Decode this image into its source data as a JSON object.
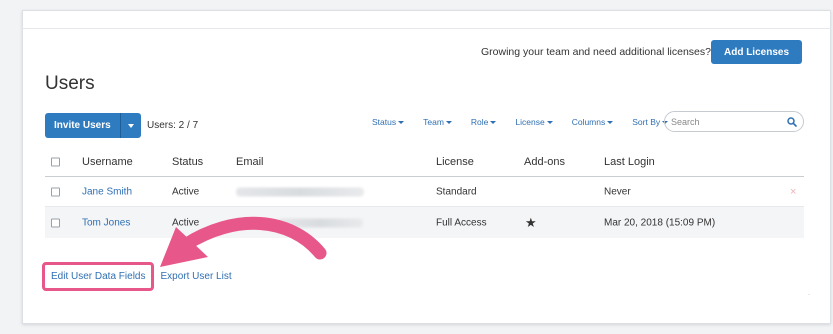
{
  "header": {
    "license_prompt": "Growing your team and need additional licenses?",
    "add_licenses_label": "Add Licenses"
  },
  "page": {
    "title": "Users"
  },
  "toolbar": {
    "invite_label": "Invite Users",
    "users_count": "Users: 2 / 7",
    "filters": [
      "Status",
      "Team",
      "Role",
      "License",
      "Columns",
      "Sort By"
    ],
    "search_placeholder": "Search"
  },
  "table": {
    "columns": [
      "Username",
      "Status",
      "Email",
      "License",
      "Add-ons",
      "Last Login"
    ],
    "rows": [
      {
        "username": "Jane Smith",
        "status": "Active",
        "license": "Standard",
        "addon": "",
        "last_login": "Never",
        "delete": "×"
      },
      {
        "username": "Tom Jones",
        "status": "Active",
        "license": "Full Access",
        "addon": "★",
        "last_login": "Mar 20, 2018 (15:09 PM)",
        "delete": ""
      }
    ]
  },
  "footer": {
    "edit_fields_label": "Edit User Data Fields",
    "export_label": "Export User List"
  },
  "colors": {
    "primary": "#2f7bbf",
    "link": "#2f6fb3",
    "highlight": "#e8578a",
    "delete": "#f2b3b8"
  }
}
